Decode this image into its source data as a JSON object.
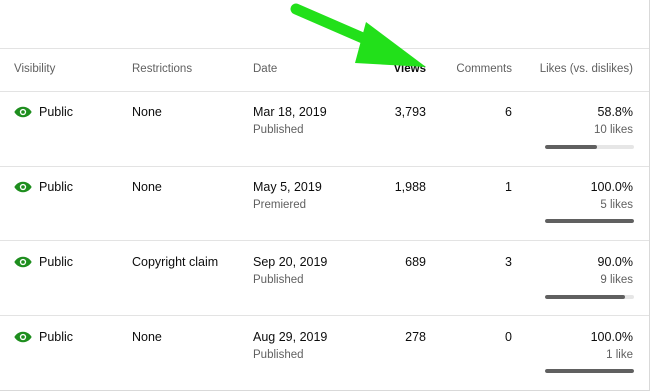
{
  "columns": {
    "visibility": "Visibility",
    "restrictions": "Restrictions",
    "date": "Date",
    "views": "Views",
    "comments": "Comments",
    "likes": "Likes (vs. dislikes)"
  },
  "rows": [
    {
      "icon": "eye-icon",
      "visibility": "Public",
      "restrictions": "None",
      "date": "Mar 18, 2019",
      "status": "Published",
      "views": "3,793",
      "comments": "6",
      "likes_pct": "58.8%",
      "likes_count": "10 likes",
      "likes_fraction": 0.588
    },
    {
      "icon": "eye-icon",
      "visibility": "Public",
      "restrictions": "None",
      "date": "May 5, 2019",
      "status": "Premiered",
      "views": "1,988",
      "comments": "1",
      "likes_pct": "100.0%",
      "likes_count": "5 likes",
      "likes_fraction": 1.0
    },
    {
      "icon": "eye-icon",
      "visibility": "Public",
      "restrictions": "Copyright claim",
      "date": "Sep 20, 2019",
      "status": "Published",
      "views": "689",
      "comments": "3",
      "likes_pct": "90.0%",
      "likes_count": "9 likes",
      "likes_fraction": 0.9
    },
    {
      "icon": "eye-icon",
      "visibility": "Public",
      "restrictions": "None",
      "date": "Aug 29, 2019",
      "status": "Published",
      "views": "278",
      "comments": "0",
      "likes_pct": "100.0%",
      "likes_count": "1 like",
      "likes_fraction": 1.0
    }
  ],
  "colors": {
    "visibility_icon": "#1e8e1e",
    "annotation_arrow": "#22e01a",
    "likes_bar_fill": "#606060",
    "likes_bar_track": "#e6e6e6"
  }
}
